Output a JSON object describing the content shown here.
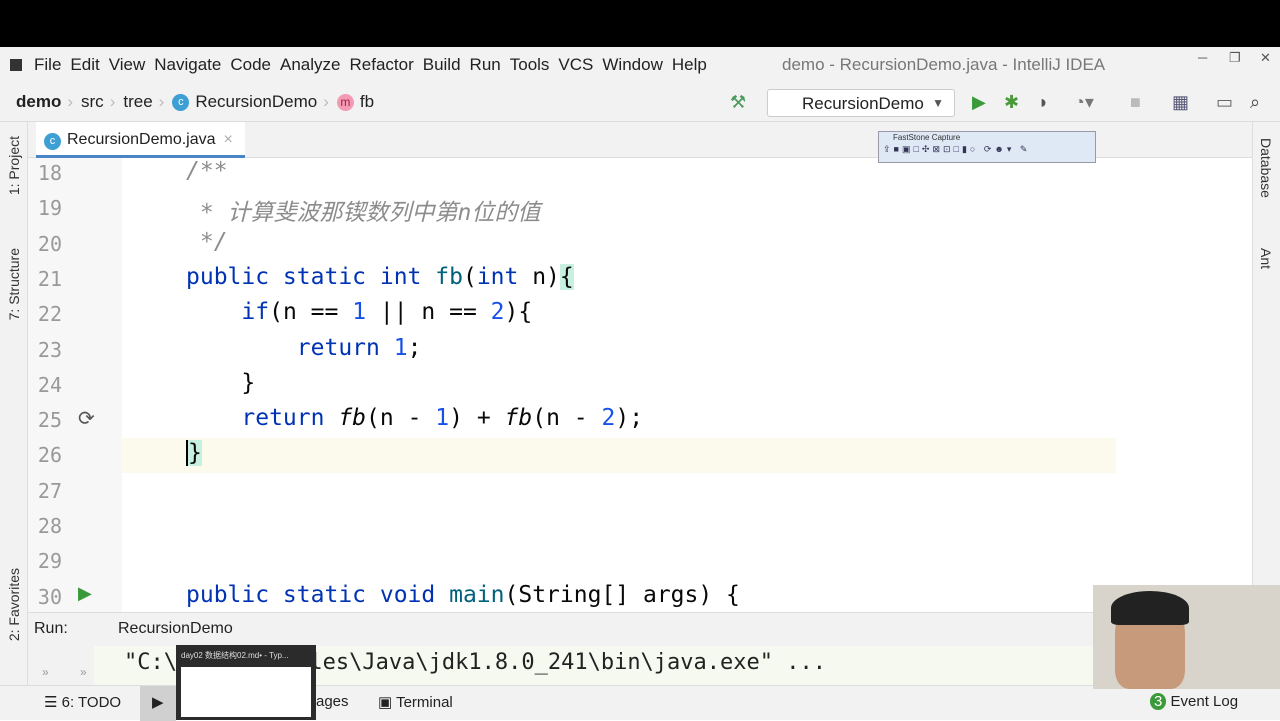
{
  "menu": [
    "File",
    "Edit",
    "View",
    "Navigate",
    "Code",
    "Analyze",
    "Refactor",
    "Build",
    "Run",
    "Tools",
    "VCS",
    "Window",
    "Help"
  ],
  "window_title": "demo - RecursionDemo.java - IntelliJ IDEA",
  "breadcrumb": [
    "demo",
    "src",
    "tree",
    "RecursionDemo",
    "fb"
  ],
  "run_config": "RecursionDemo",
  "left_tools": [
    "1: Project",
    "7: Structure",
    "2: Favorites"
  ],
  "right_tools": [
    "Database",
    "Ant"
  ],
  "editor_tab": "RecursionDemo.java",
  "fastcapture_title": "FastStone Capture",
  "code": [
    {
      "n": "18",
      "t": [
        [
          "cm",
          "/**"
        ]
      ]
    },
    {
      "n": "19",
      "t": [
        [
          "cm",
          " * 计算斐波那锲数列中第n位的值"
        ]
      ]
    },
    {
      "n": "20",
      "t": [
        [
          "cm",
          " */"
        ]
      ]
    },
    {
      "n": "21",
      "t": [
        [
          "kw",
          "public static int "
        ],
        [
          "fn",
          "fb"
        ],
        [
          "",
          "("
        ],
        [
          "kw",
          "int"
        ],
        [
          "",
          " n)"
        ],
        [
          "brace",
          "{"
        ]
      ]
    },
    {
      "n": "22",
      "t": [
        [
          "",
          "    "
        ],
        [
          "kw",
          "if"
        ],
        [
          "",
          "(n == "
        ],
        [
          "num",
          "1"
        ],
        [
          "",
          " || n == "
        ],
        [
          "num",
          "2"
        ],
        [
          "",
          "){"
        ]
      ]
    },
    {
      "n": "23",
      "t": [
        [
          "",
          "        "
        ],
        [
          "kw",
          "return "
        ],
        [
          "num",
          "1"
        ],
        [
          "",
          ";"
        ]
      ]
    },
    {
      "n": "24",
      "t": [
        [
          "",
          "    }"
        ]
      ]
    },
    {
      "n": "25",
      "t": [
        [
          "",
          "    "
        ],
        [
          "kw",
          "return "
        ],
        [
          "it",
          "fb"
        ],
        [
          "",
          "(n - "
        ],
        [
          "num",
          "1"
        ],
        [
          "",
          ") + "
        ],
        [
          "it",
          "fb"
        ],
        [
          "",
          "(n - "
        ],
        [
          "num",
          "2"
        ],
        [
          "",
          ");"
        ]
      ]
    },
    {
      "n": "26",
      "t": [
        [
          "brace",
          "}"
        ]
      ]
    },
    {
      "n": "27",
      "t": []
    },
    {
      "n": "28",
      "t": []
    },
    {
      "n": "29",
      "t": []
    },
    {
      "n": "30",
      "t": [
        [
          "kw",
          "public static void "
        ],
        [
          "fn",
          "main"
        ],
        [
          "",
          "(String[] args) {"
        ]
      ]
    }
  ],
  "run": {
    "label": "Run:",
    "tab": "RecursionDemo",
    "console": "\"C:\\Program Files\\Java\\jdk1.8.0_241\\bin\\java.exe\" ..."
  },
  "bottom": {
    "todo": "6: TODO",
    "messages": "ages",
    "terminal": "Terminal",
    "event_log": "Event Log",
    "event_count": "3"
  },
  "thumbnail_title": "day02 数据结构02.md• - Typ..."
}
